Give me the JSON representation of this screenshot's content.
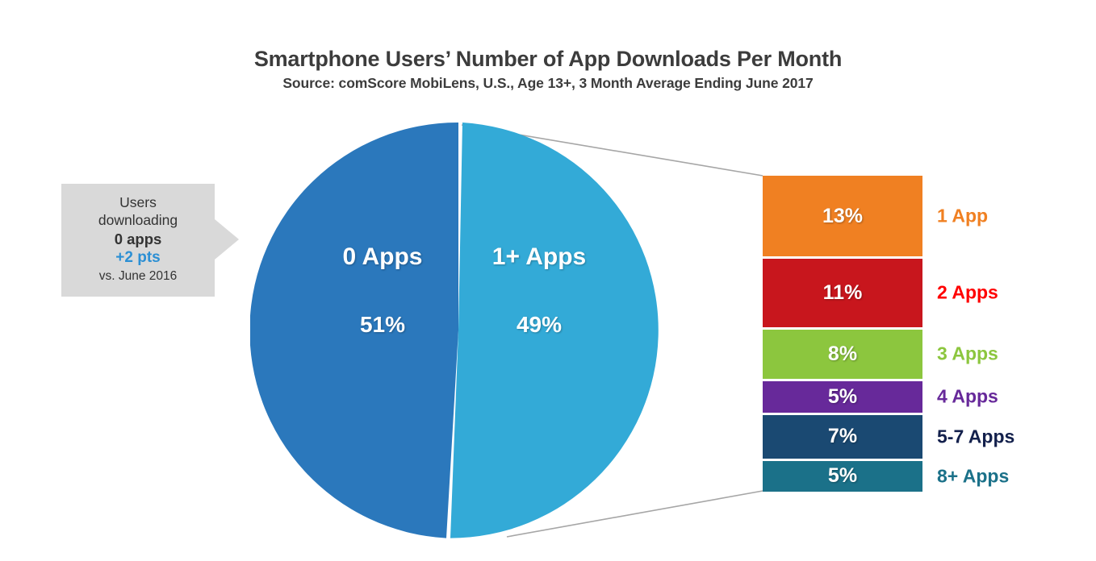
{
  "header": {
    "title": "Smartphone Users’ Number of App Downloads Per Month",
    "subtitle": "Source: comScore MobiLens, U.S., Age 13+, 3 Month Average Ending June 2017"
  },
  "callout": {
    "line1": "Users",
    "line2": "downloading",
    "line3": "0 apps",
    "delta": "+2 pts",
    "comparison": "vs. June 2016",
    "delta_color": "#2B8FD4",
    "background_color": "#D9D9D9"
  },
  "chart_data": {
    "type": "pie",
    "title": "Smartphone Users’ Number of App Downloads Per Month",
    "subtitle": "Source: comScore MobiLens, U.S., Age 13+, 3 Month Average Ending June 2017",
    "categories": [
      "0 Apps",
      "1+ Apps"
    ],
    "values": [
      51,
      49
    ],
    "value_labels": [
      "51%",
      "49%"
    ],
    "colors": [
      "#2B78BC",
      "#33AAD7"
    ],
    "unit": "%",
    "legend": "none",
    "grid": false,
    "breakout": {
      "type": "bar",
      "orientation": "stacked-vertical",
      "source_slice": "1+ Apps",
      "source_total": 49,
      "categories": [
        "1 App",
        "2 Apps",
        "3 Apps",
        "4 Apps",
        "5-7 Apps",
        "8+ Apps"
      ],
      "values": [
        13,
        11,
        8,
        5,
        7,
        5
      ],
      "value_labels": [
        "13%",
        "11%",
        "8%",
        "5%",
        "7%",
        "5%"
      ],
      "bar_colors": [
        "#F08022",
        "#C8161D",
        "#8CC63E",
        "#67299A",
        "#1A4972",
        "#1B7189"
      ],
      "label_colors": [
        "#F08022",
        "#FF0000",
        "#8CC63E",
        "#67299A",
        "#13204C",
        "#1B7189"
      ]
    }
  }
}
